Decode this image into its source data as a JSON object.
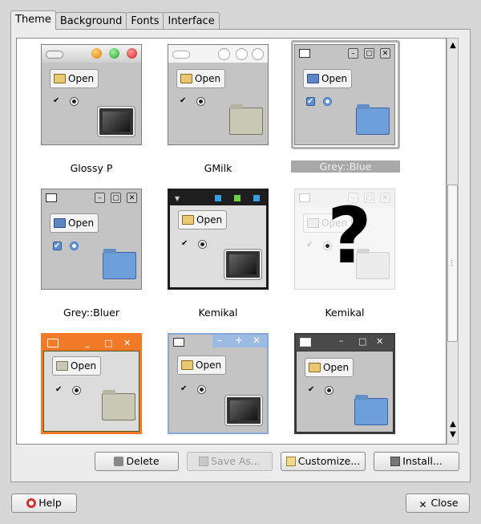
{
  "tabs": [
    "Theme",
    "Background",
    "Fonts",
    "Interface"
  ],
  "active_tab": "Theme",
  "themes": [
    {
      "name": "Glossy P",
      "open_label": "Open",
      "selected": false
    },
    {
      "name": "GMilk",
      "open_label": "Open",
      "selected": false
    },
    {
      "name": "Grey::Blue",
      "open_label": "Open",
      "selected": true
    },
    {
      "name": "Grey::Bluer",
      "open_label": "Open",
      "selected": false
    },
    {
      "name": "Kemikal",
      "open_label": "Open",
      "selected": false
    },
    {
      "name": "Kemikal",
      "open_label": "Open",
      "selected": false,
      "missing_preview": true,
      "missing_symbol": "?"
    },
    {
      "name": "",
      "open_label": "Open",
      "selected": false
    },
    {
      "name": "",
      "open_label": "Open",
      "selected": false
    },
    {
      "name": "",
      "open_label": "Open",
      "selected": false
    }
  ],
  "actions": {
    "delete": "Delete",
    "save_as": "Save As...",
    "customize": "Customize...",
    "install": "Install..."
  },
  "footer": {
    "help": "Help",
    "close": "Close"
  },
  "colors": {
    "selection": "#a8a8a8",
    "orange_theme": "#f07a28",
    "blue_theme": "#86a8d6"
  }
}
